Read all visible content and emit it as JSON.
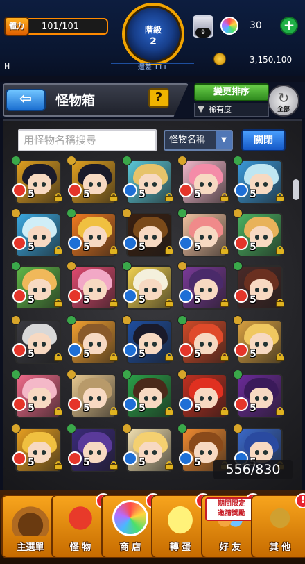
{
  "status": {
    "stamina_label": "體力",
    "stamina_value": "101/101",
    "rank_label": "階級",
    "rank_value": "2",
    "exp_remaining": "還差 111",
    "gift_count": "9",
    "orb_count": "30",
    "gold_value": "3,150,100",
    "h_mark": "H"
  },
  "header": {
    "title": "怪物箱",
    "help_label": "?",
    "sort_button": "變更排序",
    "sort_current": "稀有度",
    "all_label": "全部"
  },
  "search": {
    "placeholder": "用怪物名稱搜尋",
    "type_label": "怪物名稱",
    "close_label": "關閉"
  },
  "box": {
    "count_text": "556/830",
    "monsters": [
      {
        "level": "5",
        "hair": "#1b1b2a",
        "bg": "#e0a020",
        "element": "fire"
      },
      {
        "level": "5",
        "hair": "#1b1b2a",
        "bg": "#e0a020",
        "element": "fire"
      },
      {
        "level": "5",
        "hair": "#e7c36a",
        "bg": "#5bc8d8",
        "element": "water"
      },
      {
        "level": "5",
        "hair": "#f48ca8",
        "bg": "#f0b6c8",
        "element": "fire"
      },
      {
        "level": "5",
        "hair": "#bfe6f2",
        "bg": "#3a98d8",
        "element": "water"
      },
      {
        "level": "5",
        "hair": "#cfeef7",
        "bg": "#3aa8e0",
        "element": "fire"
      },
      {
        "level": "5",
        "hair": "#f0c040",
        "bg": "#f07a20",
        "element": "water"
      },
      {
        "level": "5",
        "hair": "#7a4a1a",
        "bg": "#3b2010",
        "element": "water"
      },
      {
        "level": "5",
        "hair": "#f08a8a",
        "bg": "#f0c0a0",
        "element": "water"
      },
      {
        "level": "5",
        "hair": "#e8b25a",
        "bg": "#4ab060",
        "element": "fire"
      },
      {
        "level": "5",
        "hair": "#f0b85a",
        "bg": "#60b848",
        "element": "fire"
      },
      {
        "level": "5",
        "hair": "#f2a8c6",
        "bg": "#e04a70",
        "element": "fire"
      },
      {
        "level": "5",
        "hair": "#f4f0dc",
        "bg": "#f2d250",
        "element": "water"
      },
      {
        "level": "5",
        "hair": "#4a2a6a",
        "bg": "#7a3a98",
        "element": "water"
      },
      {
        "level": "5",
        "hair": "#6a3020",
        "bg": "#4a2a28",
        "element": "fire"
      },
      {
        "level": "5",
        "hair": "#d8d8d8",
        "bg": "#3a3a40",
        "element": "fire"
      },
      {
        "level": "5",
        "hair": "#8a5a2a",
        "bg": "#f2a030",
        "element": "water"
      },
      {
        "level": "5",
        "hair": "#1a1a2a",
        "bg": "#1e4ea0",
        "element": "water"
      },
      {
        "level": "5",
        "hair": "#e04a2a",
        "bg": "#d04a28",
        "element": "fire"
      },
      {
        "level": "5",
        "hair": "#f0c860",
        "bg": "#d8a040",
        "element": "fire"
      },
      {
        "level": "5",
        "hair": "#f4b8c8",
        "bg": "#f06a8a",
        "element": "fire"
      },
      {
        "level": "5",
        "hair": "#b89a6a",
        "bg": "#e8c890",
        "element": "fire"
      },
      {
        "level": "5",
        "hair": "#4a2a1a",
        "bg": "#2aa048",
        "element": "water"
      },
      {
        "level": "5",
        "hair": "#e03020",
        "bg": "#c03020",
        "element": "water"
      },
      {
        "level": "5",
        "hair": "#3a1a5a",
        "bg": "#6a2a98",
        "element": "fire"
      },
      {
        "level": "5",
        "hair": "#f0c040",
        "bg": "#e8a020",
        "element": "fire"
      },
      {
        "level": "5",
        "hair": "#5a3a9a",
        "bg": "#3a2a7a",
        "element": "fire"
      },
      {
        "level": "5",
        "hair": "#f4d070",
        "bg": "#f2e0b0",
        "element": "water"
      },
      {
        "level": "5",
        "hair": "#8a4a1a",
        "bg": "#f08a30",
        "element": "water"
      },
      {
        "level": "5",
        "hair": "#2a4aa0",
        "bg": "#3a68c8",
        "element": "water"
      }
    ]
  },
  "nav": [
    {
      "label": "主選單",
      "icon": "house-icon",
      "alert": ""
    },
    {
      "label": "怪 物",
      "icon": "monster-icon",
      "alert": "!"
    },
    {
      "label": "商 店",
      "icon": "orb-shop-icon",
      "alert": "!"
    },
    {
      "label": "轉 蛋",
      "icon": "egg-icon",
      "alert": "!"
    },
    {
      "label": "好 友",
      "icon": "friends-icon",
      "alert": "!"
    },
    {
      "label": "其 他",
      "icon": "other-icon",
      "alert": "!"
    }
  ],
  "event_banner": "期間限定\n邀請獎勵",
  "colors": {
    "accent_gold": "#f2a400",
    "alert_red": "#e7232e",
    "nav_orange": "#f8a51d"
  }
}
